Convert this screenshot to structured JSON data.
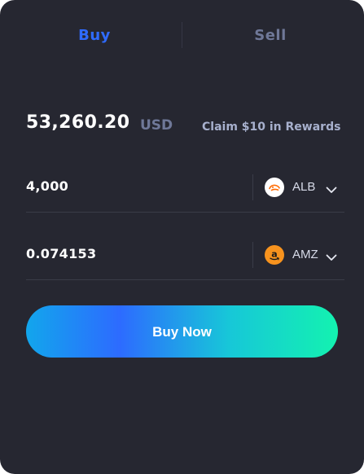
{
  "tabs": {
    "buy_label": "Buy",
    "sell_label": "Sell",
    "active": "Buy"
  },
  "amount": {
    "value": "53,260.20",
    "currency": "USD",
    "claim_link": "Claim $10 in Rewards"
  },
  "fields": [
    {
      "value": "4,000",
      "token": "ALB",
      "token_icon": "alibaba-logo-icon"
    },
    {
      "value": "0.074153",
      "token": "AMZ",
      "token_icon": "amazon-logo-icon"
    }
  ],
  "buy_button_label": "Buy Now",
  "colors": {
    "card_background": "#262731",
    "active_tab": "#2f6bff",
    "inactive_tab": "#6f7898",
    "gradient_start": "#12a6ec",
    "gradient_end": "#13f2b0",
    "amazon_orange": "#f7931e",
    "alibaba_orange": "#ff6a00"
  }
}
